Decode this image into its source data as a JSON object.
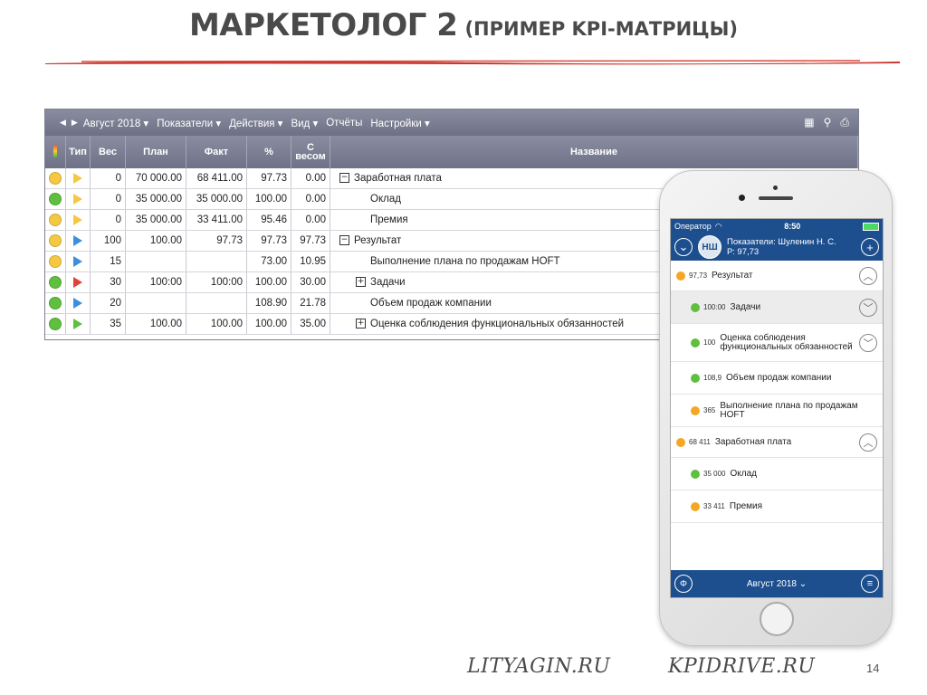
{
  "slide": {
    "title": "МАРКЕТОЛОГ 2",
    "subtitle": "(ПРИМЕР KPI-МАТРИЦЫ)",
    "footer_left": "LITYAGIN.RU",
    "footer_right": "KPIDRIVE.RU",
    "page_number": "14"
  },
  "desktop": {
    "menu": {
      "period": "Август 2018",
      "items": [
        "Показатели",
        "Действия",
        "Вид",
        "Отчёты",
        "Настройки"
      ],
      "icons": [
        "grid-icon",
        "search-icon",
        "print-icon"
      ]
    },
    "columns": [
      "Тип",
      "Вес",
      "План",
      "Факт",
      "%",
      "С весом",
      "Название"
    ],
    "rows": [
      {
        "status": "#f5c842",
        "type_color": "#f5c842",
        "weight": "0",
        "plan": "70 000.00",
        "fact": "68 411.00",
        "percent": "97.73",
        "weighted": "0.00",
        "name": "Заработная плата",
        "indent": 0,
        "expander": "−"
      },
      {
        "status": "#5fbf3f",
        "type_color": "#f5c842",
        "weight": "0",
        "plan": "35 000.00",
        "fact": "35 000.00",
        "percent": "100.00",
        "weighted": "0.00",
        "name": "Оклад",
        "indent": 2,
        "expander": ""
      },
      {
        "status": "#f5c842",
        "type_color": "#f5c842",
        "weight": "0",
        "plan": "35 000.00",
        "fact": "33 411.00",
        "percent": "95.46",
        "weighted": "0.00",
        "name": "Премия",
        "indent": 2,
        "expander": ""
      },
      {
        "status": "#f5c842",
        "type_color": "#3b8fe0",
        "weight": "100",
        "plan": "100.00",
        "fact": "97.73",
        "percent": "97.73",
        "weighted": "97.73",
        "name": "Результат",
        "indent": 0,
        "expander": "−"
      },
      {
        "status": "#f5c842",
        "type_color": "#3b8fe0",
        "weight": "15",
        "plan": "",
        "fact": "",
        "percent": "73.00",
        "weighted": "10.95",
        "name": "Выполнение плана по продажам HOFT",
        "indent": 2,
        "expander": ""
      },
      {
        "status": "#5fbf3f",
        "type_color": "#e0433b",
        "weight": "30",
        "plan": "100:00",
        "fact": "100:00",
        "percent": "100.00",
        "weighted": "30.00",
        "name": "Задачи",
        "indent": 1,
        "expander": "+"
      },
      {
        "status": "#5fbf3f",
        "type_color": "#3b8fe0",
        "weight": "20",
        "plan": "",
        "fact": "",
        "percent": "108.90",
        "weighted": "21.78",
        "name": "Объем продаж компании",
        "indent": 2,
        "expander": ""
      },
      {
        "status": "#5fbf3f",
        "type_color": "#5fbf3f",
        "weight": "35",
        "plan": "100.00",
        "fact": "100.00",
        "percent": "100.00",
        "weighted": "35.00",
        "name": "Оценка соблюдения функциональных обязанностей",
        "indent": 1,
        "expander": "+"
      }
    ]
  },
  "mobile": {
    "status": {
      "carrier": "Оператор",
      "time": "8:50"
    },
    "header": {
      "avatar": "НШ",
      "line1": "Показатели: Шуленин Н. С.",
      "line2": "Р: 97,73"
    },
    "items": [
      {
        "value": "97,73",
        "label": "Результат",
        "color": "#f5a623",
        "level": 0,
        "chevron": "up",
        "shaded": false,
        "h": 34
      },
      {
        "value": "100:00",
        "label": "Задачи",
        "color": "#5fbf3f",
        "level": 1,
        "chevron": "down",
        "shaded": true,
        "h": 36
      },
      {
        "value": "100",
        "label": "Оценка соблюдения функциональных обязанностей",
        "color": "#5fbf3f",
        "level": 1,
        "chevron": "down",
        "shaded": false,
        "h": 42
      },
      {
        "value": "108,9",
        "label": "Объем продаж компании",
        "color": "#5fbf3f",
        "level": 1,
        "chevron": "",
        "shaded": false,
        "h": 36
      },
      {
        "value": "365",
        "label": "Выполнение плана по продажам HOFT",
        "color": "#f5a623",
        "level": 1,
        "chevron": "",
        "shaded": false,
        "h": 36
      },
      {
        "value": "68 411",
        "label": "Заработная плата",
        "color": "#f5a623",
        "level": 0,
        "chevron": "up",
        "shaded": false,
        "h": 34
      },
      {
        "value": "35 000",
        "label": "Оклад",
        "color": "#5fbf3f",
        "level": 1,
        "chevron": "",
        "shaded": false,
        "h": 36
      },
      {
        "value": "33 411",
        "label": "Премия",
        "color": "#f5a623",
        "level": 1,
        "chevron": "",
        "shaded": false,
        "h": 36
      }
    ],
    "footer_period": "Август 2018 ⌄"
  }
}
